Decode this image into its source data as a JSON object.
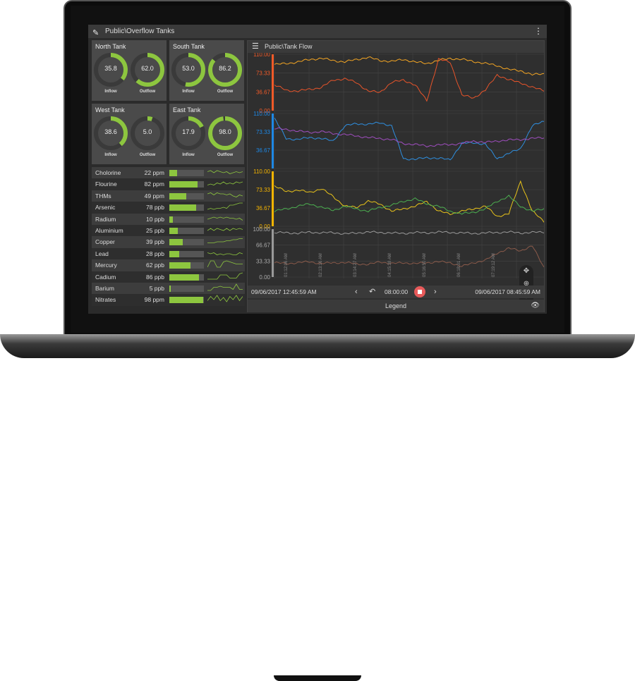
{
  "app": {
    "title": "Public\\Overflow Tanks"
  },
  "tanks": [
    {
      "name": "North Tank",
      "inflow": "35.8",
      "outflow": "62.0"
    },
    {
      "name": "South Tank",
      "inflow": "53.0",
      "outflow": "86.2"
    },
    {
      "name": "West Tank",
      "inflow": "38.6",
      "outflow": "5.0"
    },
    {
      "name": "East Tank",
      "inflow": "17.9",
      "outflow": "98.0"
    }
  ],
  "gauge_labels": {
    "inflow": "Inflow",
    "outflow": "Outflow"
  },
  "colors": {
    "accent": "#8dc63f",
    "stop": "#e85a5a"
  },
  "chemicals": [
    {
      "name": "Cholorine",
      "value": "22 ppm",
      "level": 22,
      "spark": [
        5,
        6,
        4,
        6,
        5,
        4,
        5,
        3,
        4,
        5,
        4,
        5
      ]
    },
    {
      "name": "Flourine",
      "value": "82 ppm",
      "level": 82,
      "spark": [
        3,
        4,
        3,
        5,
        4,
        6,
        4,
        5,
        4,
        6,
        5,
        6
      ]
    },
    {
      "name": "THMs",
      "value": "49 ppm",
      "level": 49,
      "spark": [
        6,
        7,
        5,
        7,
        6,
        6,
        5,
        6,
        4,
        3,
        5,
        4
      ]
    },
    {
      "name": "Arsenic",
      "value": "78 ppb",
      "level": 78,
      "spark": [
        2,
        3,
        2,
        3,
        3,
        4,
        3,
        6,
        6,
        7,
        8,
        8
      ]
    },
    {
      "name": "Radium",
      "value": "10 ppb",
      "level": 10,
      "spark": [
        4,
        5,
        6,
        5,
        6,
        5,
        6,
        5,
        5,
        4,
        5,
        3
      ]
    },
    {
      "name": "Aluminium",
      "value": "25 ppb",
      "level": 25,
      "spark": [
        4,
        6,
        4,
        6,
        5,
        4,
        6,
        4,
        6,
        5,
        6,
        5
      ]
    },
    {
      "name": "Copper",
      "value": "39 ppb",
      "level": 39,
      "spark": [
        3,
        3,
        3,
        4,
        4,
        4,
        5,
        5,
        6,
        6,
        7,
        7
      ]
    },
    {
      "name": "Lead",
      "value": "28 ppb",
      "level": 28,
      "spark": [
        5,
        4,
        5,
        3,
        4,
        3,
        4,
        4,
        3,
        3,
        5,
        4
      ]
    },
    {
      "name": "Mercury",
      "value": "62 ppb",
      "level": 62,
      "spark": [
        2,
        8,
        8,
        2,
        2,
        7,
        8,
        7,
        6,
        5,
        5,
        5
      ]
    },
    {
      "name": "Cadium",
      "value": "86 ppb",
      "level": 86,
      "spark": [
        2,
        2,
        2,
        2,
        6,
        6,
        6,
        3,
        3,
        3,
        7,
        8
      ]
    },
    {
      "name": "Barium",
      "value": "5 ppb",
      "level": 5,
      "spark": [
        2,
        2,
        5,
        5,
        6,
        5,
        5,
        5,
        3,
        8,
        3,
        3
      ]
    },
    {
      "name": "Nitrates",
      "value": "98 ppm",
      "level": 98,
      "spark": [
        3,
        7,
        4,
        8,
        3,
        6,
        2,
        7,
        4,
        8,
        3,
        7
      ]
    }
  ],
  "chart": {
    "title": "Public\\Tank Flow",
    "legend_label": "Legend",
    "start": "09/06/2017 12:45:59 AM",
    "end": "09/06/2017 08:45:59 AM",
    "duration": "08:00:00"
  },
  "chart_data": {
    "type": "line",
    "x_ticks": [
      "01:12:06 AM",
      "02:13:16 AM",
      "03:14:27 AM",
      "04:15:38 AM",
      "05:16:50 AM",
      "06:18:01 AM",
      "07:19:12 AM"
    ],
    "panels": [
      {
        "ylim": [
          0,
          110
        ],
        "ticks": [
          "110.00",
          "73.33",
          "36.67",
          "0.00"
        ],
        "axis_color": "#f05a28",
        "series": [
          {
            "color": "#f5a623",
            "values": [
              90,
              92,
              95,
              100,
              102,
              98,
              95,
              100,
              104,
              98,
              96,
              100,
              95,
              92,
              98,
              102,
              100,
              96,
              92,
              88,
              80,
              78,
              70,
              72
            ]
          },
          {
            "color": "#e8542a",
            "values": [
              50,
              40,
              38,
              42,
              45,
              60,
              62,
              55,
              38,
              36,
              55,
              60,
              50,
              20,
              100,
              95,
              30,
              25,
              40,
              70,
              60,
              55,
              45,
              40
            ]
          }
        ]
      },
      {
        "ylim": [
          0,
          110
        ],
        "ticks": [
          "110.00",
          "73.33",
          "36.67",
          ""
        ],
        "axis_color": "#1e88e5",
        "series": [
          {
            "color": "#2f8fe0",
            "values": [
              100,
              60,
              58,
              62,
              60,
              55,
              85,
              90,
              88,
              92,
              85,
              20,
              18,
              22,
              20,
              18,
              50,
              52,
              48,
              20,
              30,
              40,
              85,
              95
            ]
          },
          {
            "color": "#a04ec0",
            "values": [
              80,
              78,
              75,
              72,
              74,
              70,
              68,
              65,
              62,
              60,
              58,
              50,
              48,
              45,
              47,
              48,
              50,
              55,
              52,
              55,
              57,
              58,
              60,
              62
            ]
          }
        ]
      },
      {
        "ylim": [
          0,
          110
        ],
        "ticks": [
          "110.00",
          "73.33",
          "36.67",
          "0.00"
        ],
        "axis_color": "#f5b400",
        "series": [
          {
            "color": "#e8c21a",
            "values": [
              80,
              70,
              72,
              68,
              75,
              60,
              40,
              38,
              50,
              45,
              30,
              35,
              40,
              50,
              30,
              25,
              30,
              35,
              40,
              20,
              25,
              90,
              30,
              10
            ]
          },
          {
            "color": "#4caf50",
            "values": [
              30,
              35,
              40,
              45,
              38,
              32,
              40,
              35,
              30,
              38,
              42,
              50,
              55,
              45,
              40,
              30,
              25,
              28,
              35,
              50,
              60,
              40,
              30,
              35
            ]
          }
        ]
      },
      {
        "ylim": [
          0,
          100
        ],
        "ticks": [
          "100.00",
          "66.67",
          "33.33",
          "0.00"
        ],
        "axis_color": "#999999",
        "series": [
          {
            "color": "#9a9a9a",
            "values": [
              92,
              93,
              91,
              94,
              92,
              93,
              90,
              92,
              94,
              93,
              92,
              91,
              93,
              92,
              94,
              93,
              92,
              91,
              92,
              93,
              94,
              92,
              93,
              94
            ]
          },
          {
            "color": "#8a5a4a",
            "values": [
              30,
              28,
              30,
              32,
              28,
              30,
              30,
              28,
              26,
              32,
              28,
              30,
              28,
              30,
              32,
              30,
              22,
              30,
              35,
              50,
              60,
              55,
              65,
              20
            ]
          }
        ]
      }
    ]
  }
}
